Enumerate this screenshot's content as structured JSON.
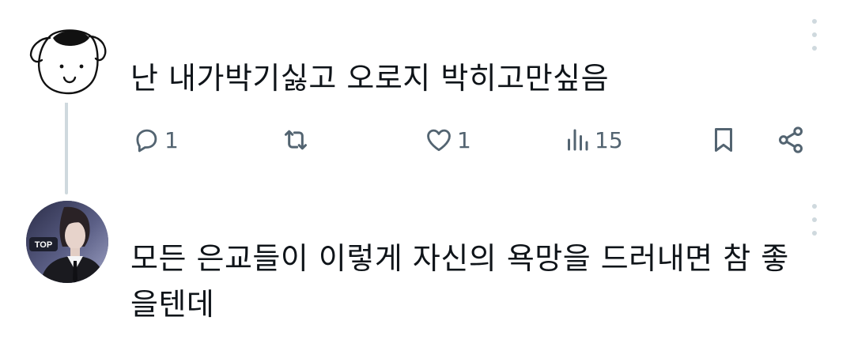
{
  "thread": [
    {
      "text": "난 내가박기싫고 오로지 박히고만싶음",
      "avatar_icon": "cartoon-dog-icon",
      "actions": {
        "reply_count": "1",
        "retweet_count": "",
        "like_count": "1",
        "views_count": "15"
      }
    },
    {
      "text": "모든 은교들이 이렇게 자신의 욕망을 드러내면 참 좋을텐데",
      "avatar_badge": "TOP"
    }
  ],
  "colors": {
    "text": "#0f1419",
    "icon_gray": "#536471",
    "thread_line": "#cfd9de"
  },
  "icons": [
    "more-vertical-icon",
    "reply-icon",
    "retweet-icon",
    "like-icon",
    "views-icon",
    "bookmark-icon",
    "share-icon"
  ]
}
